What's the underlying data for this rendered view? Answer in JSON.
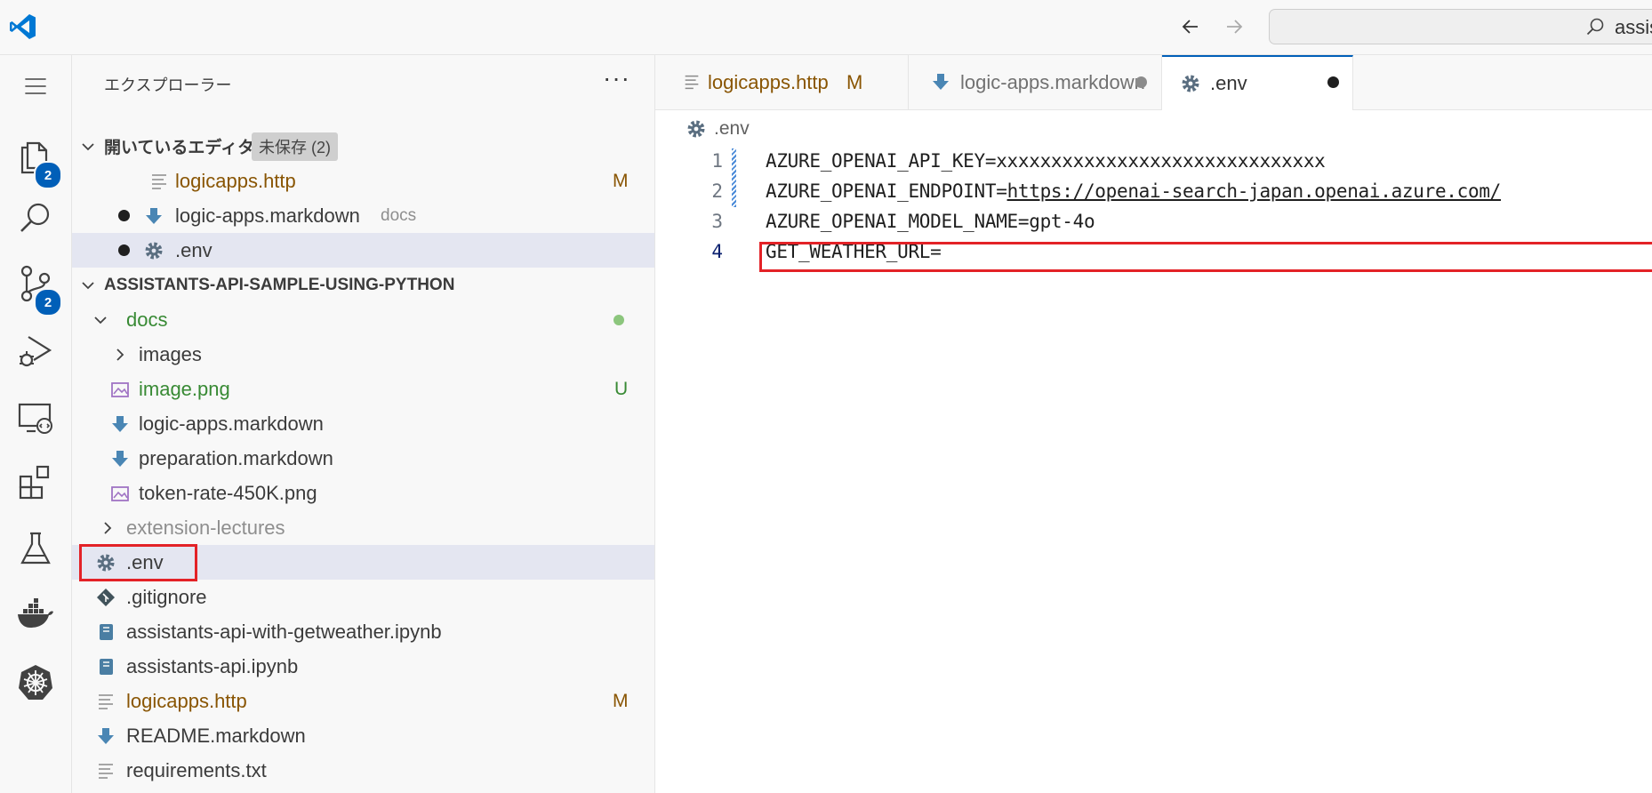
{
  "titlebar": {
    "search_text": "assis"
  },
  "activity": {
    "explorer_badge": "2",
    "scm_badge": "2"
  },
  "sidebar": {
    "title": "エクスプローラー",
    "more": "···",
    "open_editors": {
      "label": "開いているエディター",
      "unsaved_chip": "未保存 (2)",
      "items": [
        {
          "label": "logicapps.http",
          "deco": "M",
          "icon": "http-file-icon"
        },
        {
          "label": "logic-apps.markdown",
          "desc": "docs",
          "icon": "markdown-icon",
          "dirty": true
        },
        {
          "label": ".env",
          "icon": "gear-icon",
          "dirty": true
        }
      ]
    },
    "folder": {
      "label": "ASSISTANTS-API-SAMPLE-USING-PYTHON",
      "items": [
        {
          "label": "docs",
          "kind": "folder-open"
        },
        {
          "label": "images",
          "kind": "folder-closed"
        },
        {
          "label": "image.png",
          "deco": "U",
          "icon": "image-icon"
        },
        {
          "label": "logic-apps.markdown",
          "icon": "markdown-icon"
        },
        {
          "label": "preparation.markdown",
          "icon": "markdown-icon"
        },
        {
          "label": "token-rate-450K.png",
          "icon": "image-icon"
        },
        {
          "label": "extension-lectures",
          "kind": "folder-closed"
        },
        {
          "label": ".env",
          "icon": "gear-icon"
        },
        {
          "label": ".gitignore",
          "icon": "git-icon"
        },
        {
          "label": "assistants-api-with-getweather.ipynb",
          "icon": "notebook-icon"
        },
        {
          "label": "assistants-api.ipynb",
          "icon": "notebook-icon"
        },
        {
          "label": "logicapps.http",
          "deco": "M",
          "icon": "http-file-icon"
        },
        {
          "label": "README.markdown",
          "icon": "markdown-icon"
        },
        {
          "label": "requirements.txt",
          "icon": "text-file-icon"
        }
      ]
    }
  },
  "editor": {
    "tabs": [
      {
        "label": "logicapps.http",
        "deco": "M"
      },
      {
        "label": "logic-apps.markdown"
      },
      {
        "label": ".env"
      }
    ],
    "breadcrumb": ".env",
    "lines": [
      {
        "n": "1",
        "key": "AZURE_OPENAI_API_KEY=",
        "val": "xxxxxxxxxxxxxxxxxxxxxxxxxxxxxx"
      },
      {
        "n": "2",
        "key": "AZURE_OPENAI_ENDPOINT=",
        "val": "https://openai-search-japan.openai.azure.com/"
      },
      {
        "n": "3",
        "key": "AZURE_OPENAI_MODEL_NAME=",
        "val": "gpt-4o"
      },
      {
        "n": "4",
        "key": "GET_WEATHER_URL=",
        "val": ""
      }
    ]
  },
  "colors": {
    "accent": "#005fb8",
    "modified": "#895503",
    "untracked": "#388a34",
    "highlight_box": "#e32227"
  }
}
